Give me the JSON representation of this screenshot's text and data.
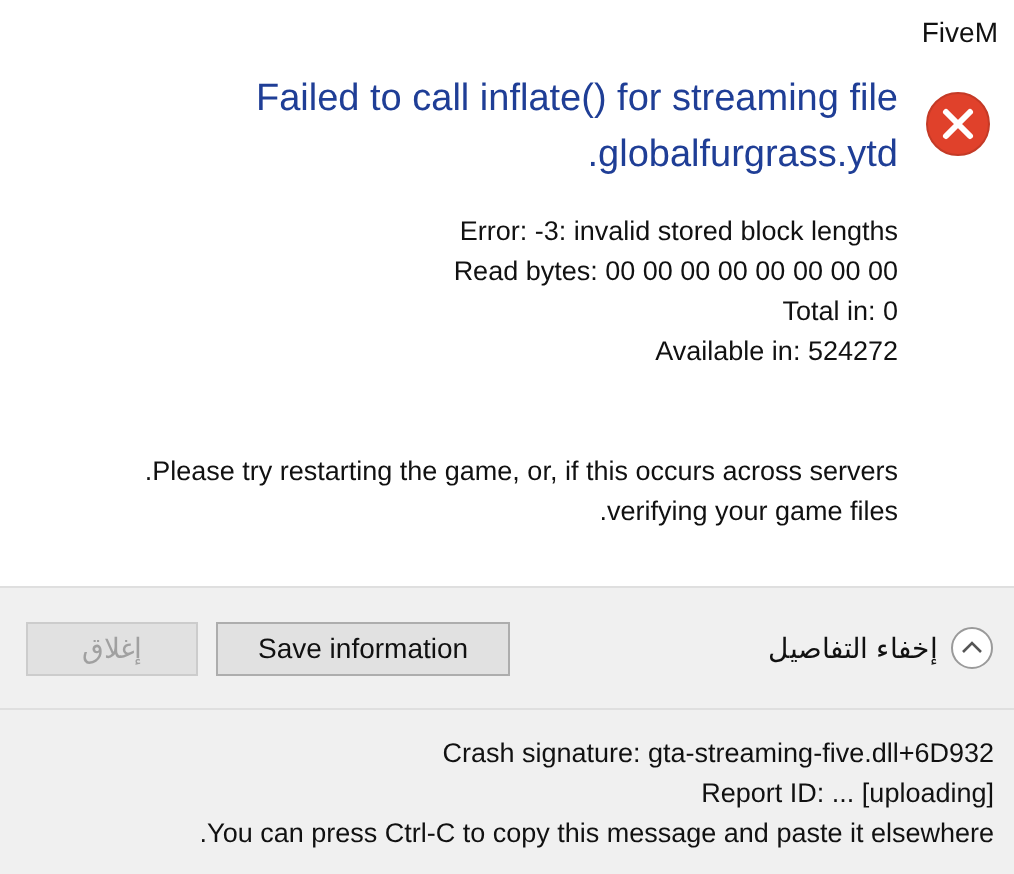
{
  "window": {
    "title": "FiveM"
  },
  "heading": [
    "Failed to call inflate() for streaming file",
    ".globalfurgrass.ytd"
  ],
  "details": [
    "Error: -3: invalid stored block lengths",
    "Read bytes: 00 00 00 00 00 00 00 00",
    "Total in: 0",
    "Available in: 524272"
  ],
  "message": [
    ".Please try restarting the game, or, if this occurs across servers",
    ".verifying your game files"
  ],
  "buttons": [
    {
      "label": "إغلاق",
      "disabled": true
    },
    {
      "label": "Save information",
      "disabled": false
    }
  ],
  "expander": {
    "label": "إخفاء التفاصيل",
    "expanded": true
  },
  "footer_lines": [
    "Crash signature: gta-streaming-five.dll+6D932",
    "Report ID: ... [uploading]",
    ".You can press Ctrl-C to copy this message and paste it elsewhere"
  ]
}
